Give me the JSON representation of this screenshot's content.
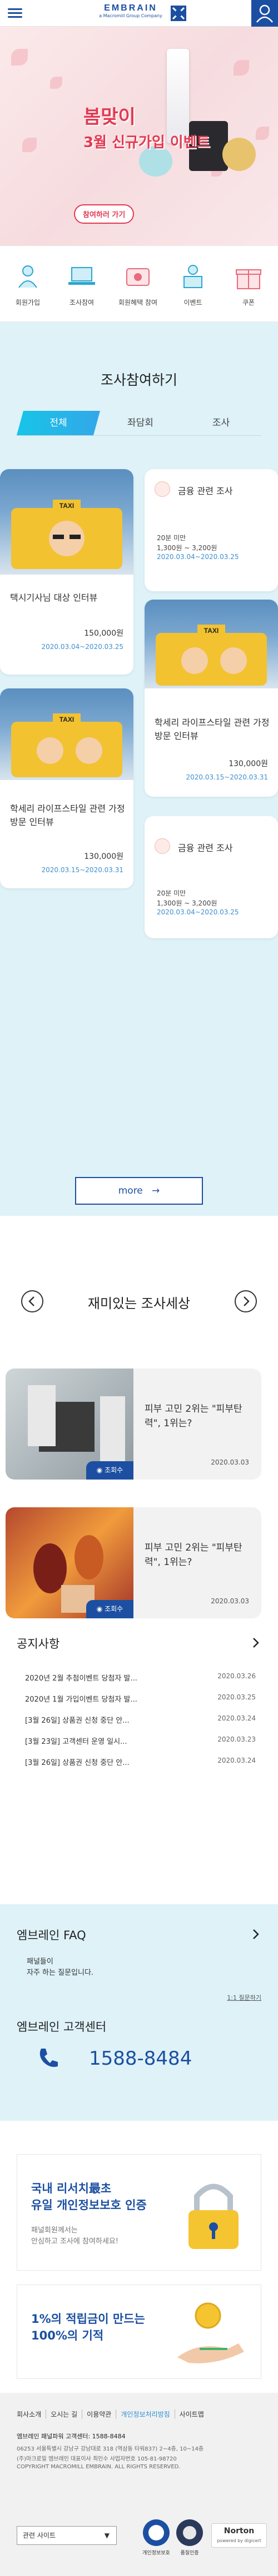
{
  "header": {
    "logo_text": "EMBRAIN",
    "logo_sub": "a Macromill Group Company"
  },
  "banner": {
    "title_line1": "봄맞이",
    "title_line2": "3월 신규가입 이벤트",
    "button_label": "참여하러 가기"
  },
  "quick_menu": [
    {
      "label": "회원가입",
      "icon": "person-add-icon"
    },
    {
      "label": "조사참여",
      "icon": "survey-laptop-icon"
    },
    {
      "label": "회원혜택 참여",
      "icon": "benefit-icon"
    },
    {
      "label": "이벤트",
      "icon": "event-icon"
    },
    {
      "label": "쿠폰",
      "icon": "gift-icon"
    }
  ],
  "survey": {
    "title": "조사참여하기",
    "tabs": [
      "전체",
      "좌담회",
      "조사"
    ],
    "cards": [
      {
        "title": "택시기사님 대상 인터뷰",
        "price": "150,000원",
        "date": "2020.03.04~2020.03.25"
      },
      {
        "type": "info",
        "title": "금융 관련 조사",
        "time": "20분 미만",
        "reward": "1,300원 ~ 3,200원",
        "date": "2020.03.04~2020.03.25"
      },
      {
        "title": "택시기사님 대상 인터뷰",
        "price": "",
        "date": ""
      },
      {
        "title": "학세리 라이프스타일 관련 가정방문 인터뷰",
        "price": "130,000원",
        "date": "2020.03.15~2020.03.31"
      },
      {
        "title": "학세리 라이프스타일 관련 가정방문 인터뷰",
        "price": "130,000원",
        "date": "2020.03.15~2020.03.31"
      },
      {
        "type": "info",
        "title": "금융 관련 조사",
        "time": "20분 미만",
        "reward": "1,300원 ~ 3,200원",
        "date": "2020.03.04~2020.03.25"
      }
    ],
    "more_label": "more"
  },
  "fun": {
    "title": "재미있는 조사세상",
    "cards": [
      {
        "title": "피부 고민 2위는 \"피부탄력\", 1위는?",
        "views": "조회수",
        "date": "2020.03.03"
      },
      {
        "title": "피부 고민 2위는 \"피부탄력\", 1위는?",
        "views": "조회수",
        "date": "2020.03.03"
      }
    ]
  },
  "notice": {
    "title": "공지사항",
    "items": [
      {
        "text": "2020년 2월 추첨이벤트 당첨자 발...",
        "date": "2020.03.26"
      },
      {
        "text": "2020년 1월 가입이벤트 당첨자 발...",
        "date": "2020.03.25"
      },
      {
        "text": "[3월 26일] 상품권 신청 중단 안...",
        "date": "2020.03.24"
      },
      {
        "text": "[3월 23일] 고객센터 운영 일시...",
        "date": "2020.03.23"
      },
      {
        "text": "[3월 26일] 상품권 신청 중단 안...",
        "date": "2020.03.24"
      }
    ]
  },
  "faq": {
    "title": "엠브레인 FAQ",
    "question": "패널들이",
    "question2": "자주 하는 질문입니다.",
    "link": "1:1 질문하기",
    "center_title": "엠브레인 고객센터",
    "phone": "1588-8484"
  },
  "promo": {
    "p1_line1": "국내 리서치最초",
    "p1_line2": "유일 개인정보보호 인증",
    "p1_sub1": "패널회원께서는",
    "p1_sub2": "안심하고 조사에 참여하세요!",
    "p2_line1": "1%의 적립금이 만드는",
    "p2_line2": "100%의 기적"
  },
  "footer": {
    "links": [
      "회사소개",
      "오시는 길",
      "이용약관",
      "개인정보처리방침",
      "사이트맵"
    ],
    "cs": "엠브레인 패널파워 고객센터: 1588-8484",
    "addr1": "06253 서울특별시 강남구 강남대로 318 (역삼동 타워837) 2~4층, 10~14층",
    "addr2": "(주)마크로밀 엠브레인 대표이사 최인수 사업자번호 105-81-98720",
    "copyright": "COPYRIGHT MACROMILL EMBRAIN. ALL RIGHTS RESERVED.",
    "select_label": "관련 사이트",
    "cert1": "개인정보보호",
    "cert2": "품질인증",
    "cert3": "Norton",
    "cert4": "powered by digicert"
  },
  "colors": {
    "brand": "#1c4fa1",
    "accent_pink": "#e23a52",
    "light_blue": "#def2f8",
    "cyan": "#17c5e8"
  }
}
